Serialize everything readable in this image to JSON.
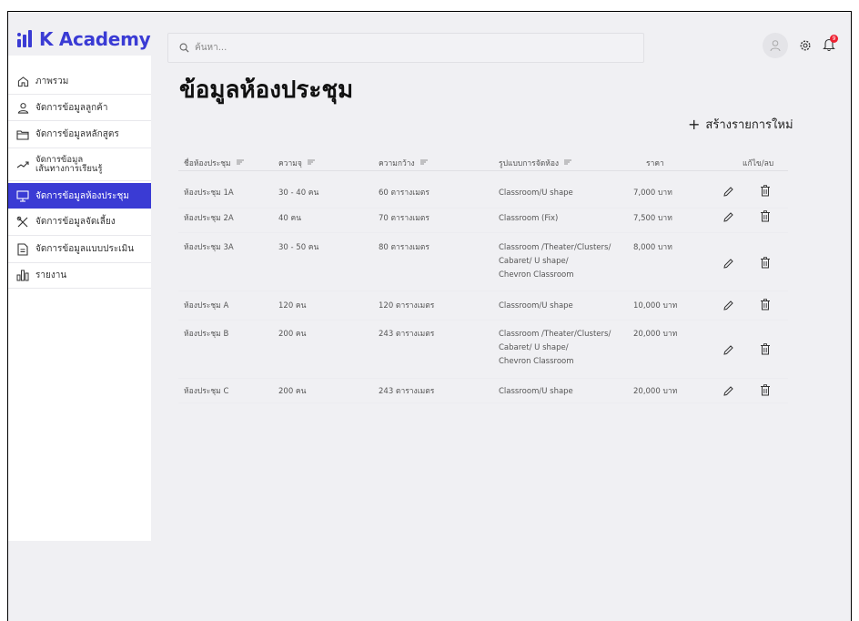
{
  "app": {
    "logo_text": "K Academy"
  },
  "search": {
    "placeholder": "ค้นหา..."
  },
  "notifications": {
    "count": "9"
  },
  "sidebar": {
    "items": [
      {
        "label": "ภาพรวม"
      },
      {
        "label": "จัดการข้อมูลลูกค้า"
      },
      {
        "label": "จัดการข้อมูลหลักสูตร"
      },
      {
        "label_line1": "จัดการข้อมูล",
        "label_line2": "เส้นทางการเรียนรู้"
      },
      {
        "label": "จัดการข้อมูลห้องประชุม"
      },
      {
        "label": "จัดการข้อมูลจัดเลี้ยง"
      },
      {
        "label": "จัดการข้อมูลแบบประเมิน"
      },
      {
        "label": "รายงาน"
      }
    ]
  },
  "page": {
    "title": "ข้อมูลห้องประชุม",
    "create_label": "สร้างรายการใหม่"
  },
  "table": {
    "headers": {
      "name": "ชื่อห้องประชุม",
      "capacity": "ความจุ",
      "area": "ความกว้าง",
      "layout": "รูปแบบการจัดห้อง",
      "price": "ราคา",
      "actions": "แก้ไข/ลบ"
    },
    "rows": [
      {
        "name": "ห้องประชุม 1A",
        "capacity": "30 - 40 คน",
        "area": "60 ตารางเมตร",
        "layout1": "Classroom/U shape",
        "layout2": "",
        "layout3": "",
        "price": "7,000 บาท"
      },
      {
        "name": "ห้องประชุม 2A",
        "capacity": "40 คน",
        "area": "70 ตารางเมตร",
        "layout1": "Classroom (Fix)",
        "layout2": "",
        "layout3": "",
        "price": "7,500 บาท"
      },
      {
        "name": "ห้องประชุม 3A",
        "capacity": "30 - 50 คน",
        "area": "80 ตารางเมตร",
        "layout1": "Classroom /Theater/Clusters/",
        "layout2": "Cabaret/ U shape/",
        "layout3": "Chevron Classroom",
        "price": "8,000 บาท"
      },
      {
        "name": "ห้องประชุม A",
        "capacity": "120 คน",
        "area": "120 ตารางเมตร",
        "layout1": "Classroom/U shape",
        "layout2": "",
        "layout3": "",
        "price": "10,000 บาท"
      },
      {
        "name": "ห้องประชุม B",
        "capacity": "200 คน",
        "area": "243 ตารางเมตร",
        "layout1": "Classroom /Theater/Clusters/",
        "layout2": "Cabaret/ U shape/",
        "layout3": "Chevron Classroom",
        "price": "20,000 บาท"
      },
      {
        "name": "ห้องประชุม C",
        "capacity": "200 คน",
        "area": "243 ตารางเมตร",
        "layout1": "Classroom/U shape",
        "layout2": "",
        "layout3": "",
        "price": "20,000 บาท"
      }
    ]
  },
  "colors": {
    "accent": "#3a3bd4",
    "badge": "#ee2233",
    "background": "#f0f0f3"
  }
}
